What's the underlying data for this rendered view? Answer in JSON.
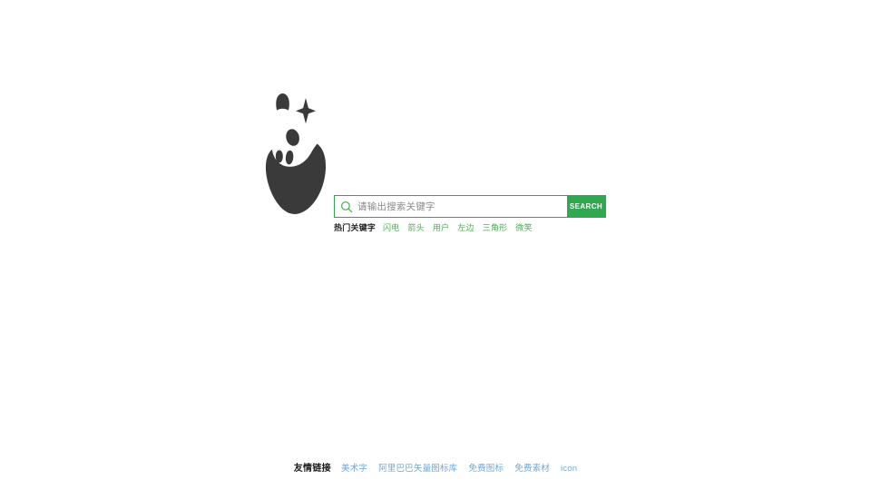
{
  "colors": {
    "logo_dark": "#3a3a3a",
    "accent_green": "#2fa84f",
    "link_green": "#4caf50",
    "link_blue": "#6ea8dd",
    "page_background": "#ffffff",
    "placeholder_gray": "#8a8a8a"
  },
  "logo": {
    "name": "mascot-blob-logo",
    "description": "dark abstract blob mascot with arch and sparkle"
  },
  "search": {
    "icon": "search-icon",
    "placeholder": "请输出搜索关键字",
    "value": "",
    "button_label": "SEARCH"
  },
  "hot_keywords": {
    "label": "热门关键字",
    "items": [
      {
        "label": "闪电"
      },
      {
        "label": "箭头"
      },
      {
        "label": "用户"
      },
      {
        "label": "左边"
      },
      {
        "label": "三角形"
      },
      {
        "label": "微笑"
      }
    ]
  },
  "footer": {
    "label": "友情链接",
    "links": [
      {
        "label": "美术字"
      },
      {
        "label": "阿里巴巴矢量图标库"
      },
      {
        "label": "免费图标"
      },
      {
        "label": "免费素材"
      },
      {
        "label": "icon"
      }
    ]
  }
}
